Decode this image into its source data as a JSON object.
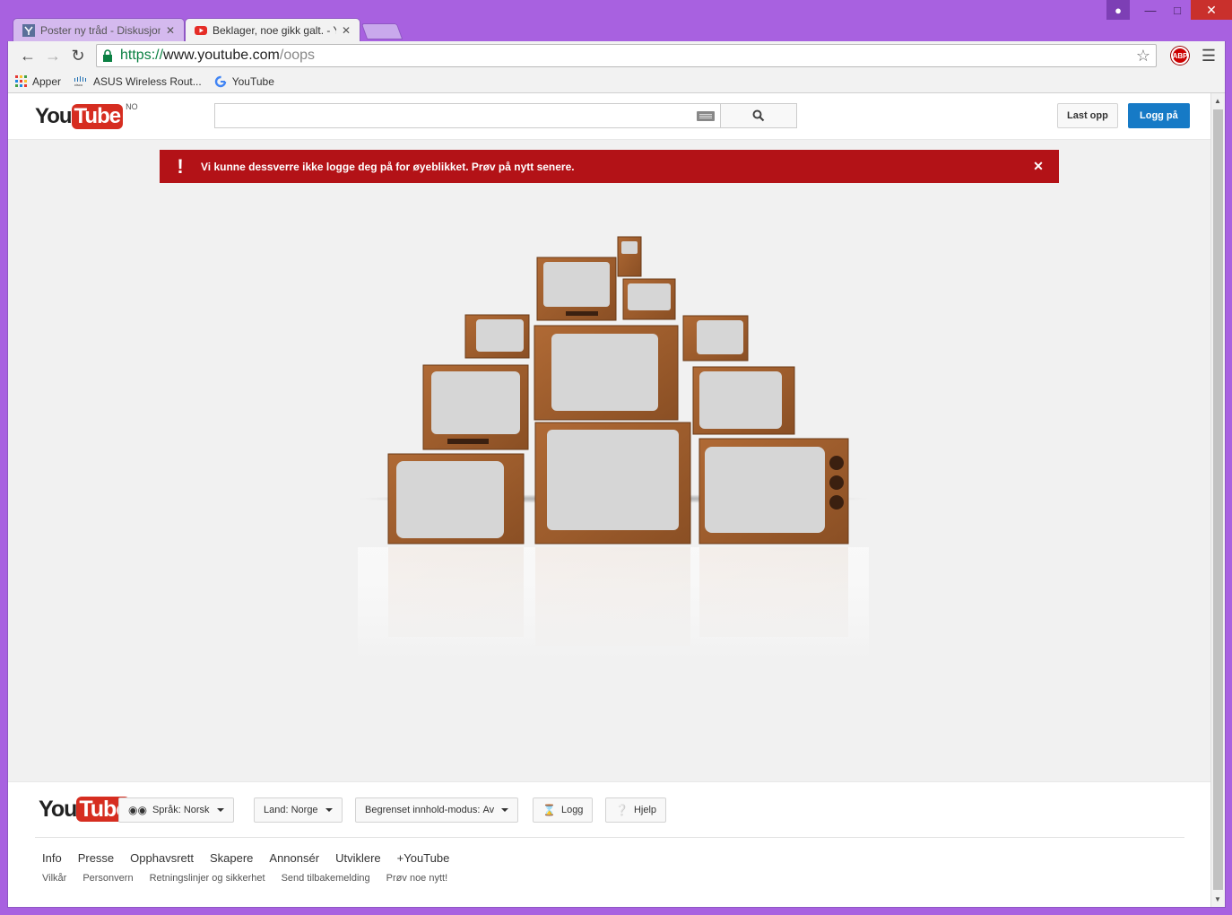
{
  "tabs": [
    {
      "title": "Poster ny tråd - Diskusjon",
      "active": false
    },
    {
      "title": "Beklager, noe gikk galt. - YouTube",
      "active": true
    }
  ],
  "omnibox": {
    "scheme": "https://",
    "host": "www.youtube.com",
    "path": "/oops"
  },
  "bookmarks": [
    {
      "label": "Apper",
      "icon": "apps-grid-icon"
    },
    {
      "label": "ASUS Wireless Rout...",
      "icon": "cisco-icon"
    },
    {
      "label": "YouTube",
      "icon": "google-icon"
    }
  ],
  "extension": {
    "abp_label": "ABP"
  },
  "header": {
    "logo_you": "You",
    "logo_tube": "Tube",
    "region": "NO",
    "search_placeholder": "",
    "upload_label": "Last opp",
    "login_label": "Logg på"
  },
  "alert": {
    "message": "Vi kunne dessverre ikke logge deg på for øyeblikket. Prøv på nytt senere.",
    "color": "#b31217"
  },
  "footer": {
    "language_label": "Språk:",
    "language_value": "Norsk",
    "country_label": "Land:",
    "country_value": "Norge",
    "restricted_label": "Begrenset innhold-modus:",
    "restricted_value": "Av",
    "history_label": "Logg",
    "help_label": "Hjelp",
    "links_primary": [
      "Info",
      "Presse",
      "Opphavsrett",
      "Skapere",
      "Annonsér",
      "Utviklere",
      "+YouTube"
    ],
    "links_secondary": [
      "Vilkår",
      "Personvern",
      "Retningslinjer og sikkerhet",
      "Send tilbakemelding",
      "Prøv noe nytt!"
    ]
  },
  "colors": {
    "brand_red": "#d62d20",
    "login_blue": "#167ac6",
    "frame_purple": "#a861e0",
    "tv_wood": "#9a5b2e"
  }
}
